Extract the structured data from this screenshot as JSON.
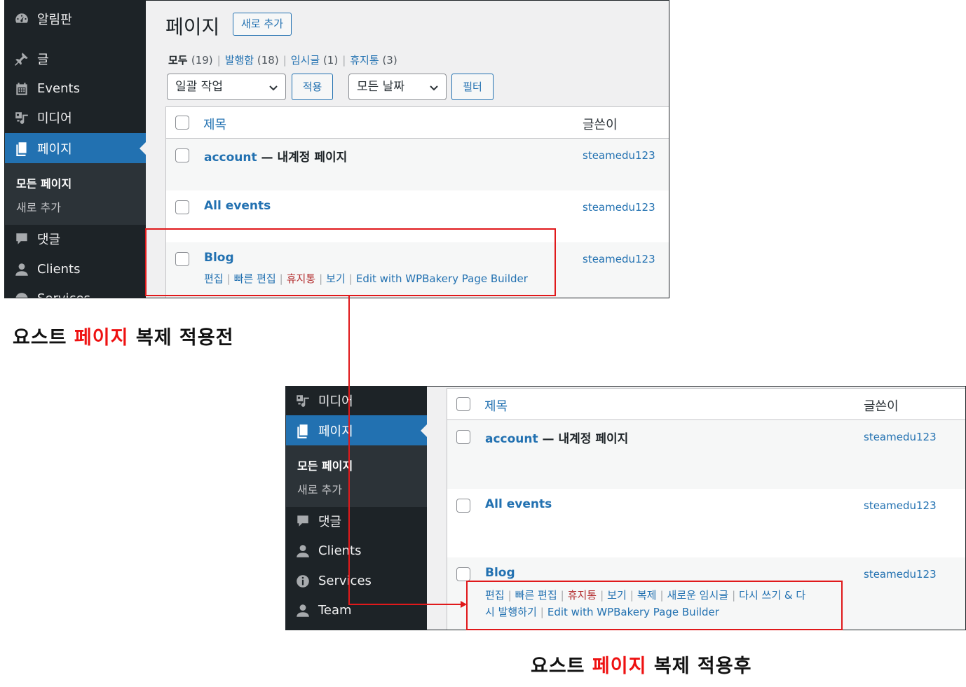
{
  "sidebar_top": {
    "dashboard": "알림판",
    "posts": "글",
    "events": "Events",
    "media": "미디어",
    "pages": "페이지",
    "all_pages": "모든 페이지",
    "add_new": "새로 추가",
    "comments": "댓글",
    "clients": "Clients",
    "services": "Services"
  },
  "sidebar_bottom": {
    "media": "미디어",
    "pages": "페이지",
    "all_pages": "모든 페이지",
    "add_new": "새로 추가",
    "comments": "댓글",
    "clients": "Clients",
    "services": "Services",
    "team": "Team"
  },
  "header": {
    "title": "페이지",
    "add_new": "새로 추가"
  },
  "filters": {
    "all": "모두",
    "all_count": "(19)",
    "published": "발행함",
    "published_count": "(18)",
    "drafts": "임시글",
    "drafts_count": "(1)",
    "trash": "휴지통",
    "trash_count": "(3)",
    "sep": "|"
  },
  "toolbar": {
    "bulk_actions": "일괄 작업",
    "apply": "적용",
    "all_dates": "모든 날짜",
    "filter": "필터"
  },
  "table": {
    "col_title": "제목",
    "col_author": "글쓴이",
    "rows": [
      {
        "title": "account",
        "suffix": " — 내계정 페이지",
        "author": "steamedu123"
      },
      {
        "title": "All events",
        "author": "steamedu123"
      },
      {
        "title": "Blog",
        "author": "steamedu123"
      }
    ]
  },
  "actions_before": {
    "edit": "편집",
    "quick_edit": "빠른 편집",
    "trash": "휴지통",
    "view": "보기",
    "wpbakery": "Edit with WPBakery Page Builder",
    "sep": "|"
  },
  "actions_after": {
    "edit": "편집",
    "quick_edit": "빠른 편집",
    "trash": "휴지통",
    "view": "보기",
    "clone": "복제",
    "new_draft": "새로운 임시글",
    "rewrite_1": "다시 쓰기 & 다",
    "rewrite_2": "시 발행하기",
    "wpbakery": "Edit with WPBakery Page Builder",
    "sep": "|"
  },
  "captions": {
    "before_prefix": "요스트 ",
    "before_highlight": "페이지",
    "before_suffix": " 복제 적용전",
    "after_prefix": "요스트 ",
    "after_highlight": "페이지",
    "after_suffix": " 복제 적용후"
  },
  "colors": {
    "accent": "#2271b1",
    "sidebar_bg": "#1d2327",
    "annotation": "#e0191b",
    "trash": "#b32d2e"
  }
}
